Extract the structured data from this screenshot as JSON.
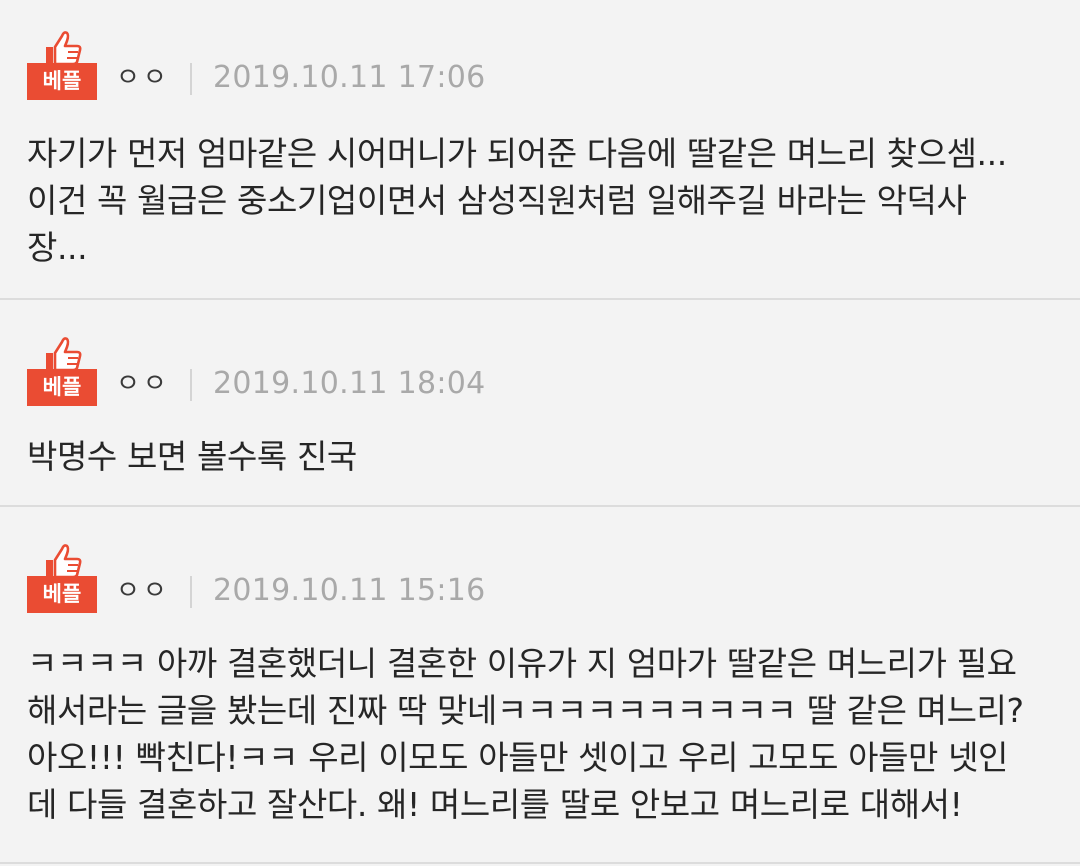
{
  "comments": [
    {
      "badge": "베플",
      "author": "ㅇㅇ",
      "date": "2019.10.11 17:06",
      "lines": [
        "자기가 먼저 엄마같은 시어머니가 되어준 다음에 딸같은 며느리 찾으셈...",
        "이건 꼭 월급은 중소기업이면서 삼성직원처럼 일해주길 바라는 악덕사",
        "장..."
      ]
    },
    {
      "badge": "베플",
      "author": "ㅇㅇ",
      "date": "2019.10.11 18:04",
      "lines": [
        "박명수 보면 볼수록 진국"
      ]
    },
    {
      "badge": "베플",
      "author": "ㅇㅇ",
      "date": "2019.10.11 15:16",
      "lines": [
        "ㅋㅋㅋㅋ 아까 결혼했더니 결혼한 이유가 지 엄마가 딸같은 며느리가 필요",
        "해서라는 글을 봤는데 진짜 딱 맞네ㅋㅋㅋㅋㅋㅋㅋㅋㅋㅋ 딸 같은 며느리?",
        "아오!!! 빡친다!ㅋㅋ 우리 이모도 아들만 셋이고 우리 고모도 아들만 넷인",
        "데 다들 결혼하고 잘산다. 왜! 며느리를 딸로 안보고 며느리로 대해서!"
      ]
    }
  ],
  "colors": {
    "background": "#f3f3f3",
    "badge_red": "#ea4c33",
    "date_gray": "#a9a9a9",
    "divider": "#dcdcdc"
  },
  "icons": {
    "badge_icon": "thumbs-up-icon"
  }
}
